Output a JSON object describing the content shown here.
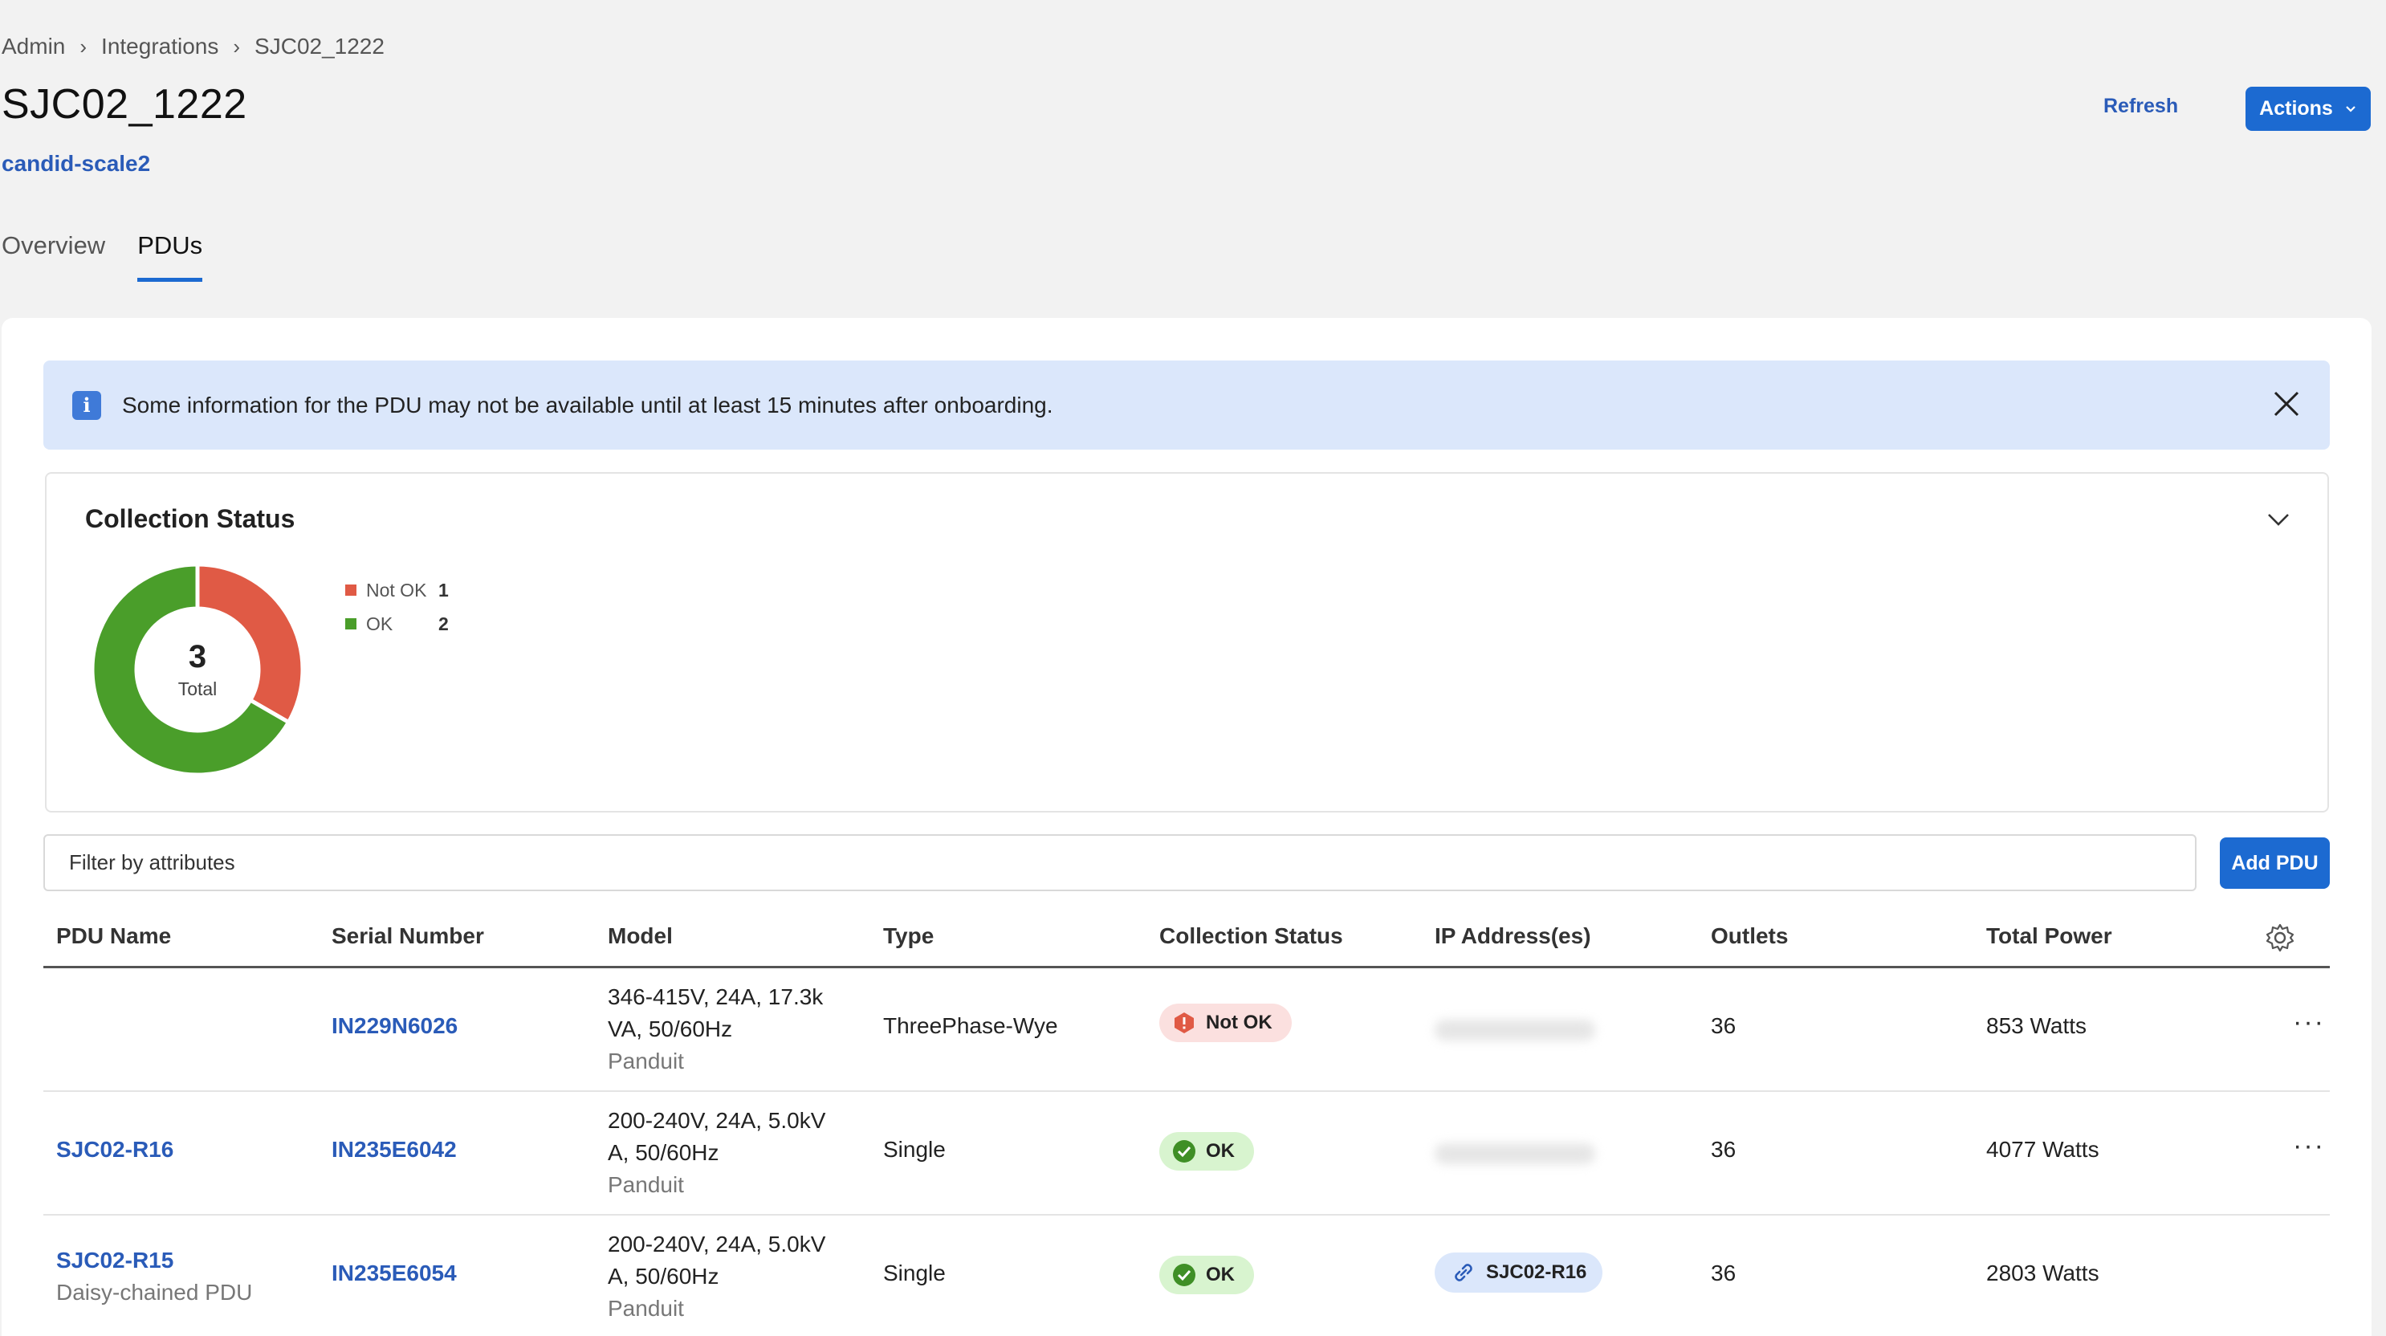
{
  "breadcrumb": [
    "Admin",
    "Integrations",
    "SJC02_1222"
  ],
  "page": {
    "title": "SJC02_1222",
    "subtitle": "candid-scale2"
  },
  "header": {
    "refresh_label": "Refresh",
    "actions_label": "Actions"
  },
  "tabs": [
    {
      "label": "Overview",
      "active": false
    },
    {
      "label": "PDUs",
      "active": true
    }
  ],
  "banner": {
    "info_glyph": "i",
    "message": "Some information for the PDU may not be available until at least 15 minutes after onboarding."
  },
  "collection": {
    "title": "Collection Status",
    "total": "3",
    "total_label": "Total",
    "legend": [
      {
        "name": "Not OK",
        "value": "1",
        "color": "#e05a45"
      },
      {
        "name": "OK",
        "value": "2",
        "color": "#4a9e2a"
      }
    ]
  },
  "filter": {
    "placeholder": "Filter by attributes"
  },
  "add_pdu_label": "Add PDU",
  "table": {
    "headers": [
      "PDU Name",
      "Serial Number",
      "Model",
      "Type",
      "Collection Status",
      "IP Address(es)",
      "Outlets",
      "Total Power"
    ],
    "rows": [
      {
        "name": "",
        "sub": "",
        "serial": "IN229N6026",
        "model_l1": "346-415V, 24A, 17.3k",
        "model_l2": "VA, 50/60Hz",
        "vendor": "Panduit",
        "type": "ThreePhase-Wye",
        "status": "Not OK",
        "status_kind": "bad",
        "ip": "",
        "ip_chip": "",
        "outlets": "36",
        "power": "853 Watts",
        "more": "···"
      },
      {
        "name": "SJC02-R16",
        "sub": "",
        "serial": "IN235E6042",
        "model_l1": "200-240V, 24A, 5.0kV",
        "model_l2": "A, 50/60Hz",
        "vendor": "Panduit",
        "type": "Single",
        "status": "OK",
        "status_kind": "good",
        "ip": "",
        "ip_chip": "",
        "outlets": "36",
        "power": "4077 Watts",
        "more": "···"
      },
      {
        "name": "SJC02-R15",
        "sub": "Daisy-chained PDU",
        "serial": "IN235E6054",
        "model_l1": "200-240V, 24A, 5.0kV",
        "model_l2": "A, 50/60Hz",
        "vendor": "Panduit",
        "type": "Single",
        "status": "OK",
        "status_kind": "good",
        "ip": "",
        "ip_chip": "SJC02-R16",
        "outlets": "36",
        "power": "2803 Watts",
        "more": ""
      }
    ]
  },
  "colors": {
    "accent": "#1c6ad1",
    "link": "#2a5bb8",
    "not_ok": "#e05a45",
    "ok": "#4a9e2a",
    "banner_bg": "#dbe7fb"
  }
}
